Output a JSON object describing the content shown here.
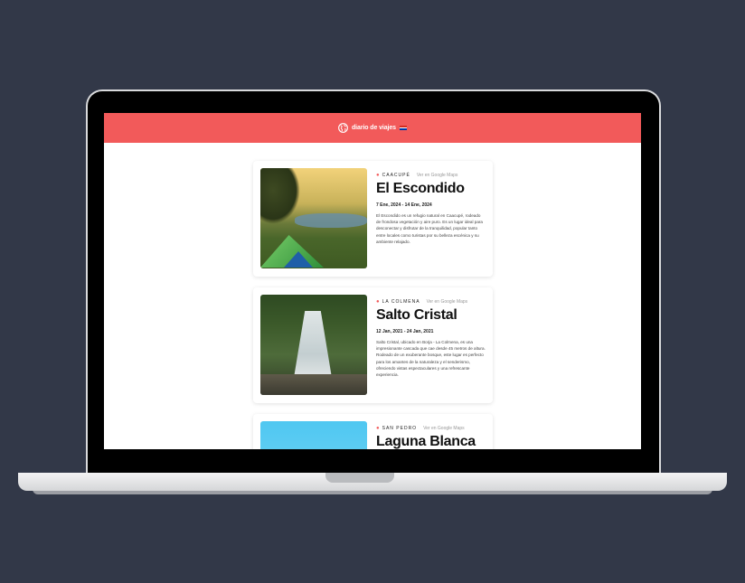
{
  "header": {
    "brand": "diario de viajes",
    "accent": "#f25a5a"
  },
  "cards": [
    {
      "location": "CAACUPÉ",
      "maps_link": "Ver en Google Maps",
      "title": "El Escondido",
      "dates": "7 Ene, 2024 - 14 Ene, 2024",
      "description": "El Escondido es un refugio natural en Caacupé, rodeado de frondosa vegetación y aire puro. Es un lugar ideal para desconectar y disfrutar de la tranquilidad, popular tanto entre locales como turistas por su belleza escénica y su ambiente relajado."
    },
    {
      "location": "LA COLMENA",
      "maps_link": "Ver en Google Maps",
      "title": "Salto Cristal",
      "dates": "12 Jan, 2021 - 24 Jan, 2021",
      "description": "Salto Cristal, ubicado en Borja - La Colmena, es una impresionante cascada que cae desde 45 metros de altura. Rodeado de un exuberante bosque, este lugar es perfecto para los amantes de la naturaleza y el senderismo, ofreciendo vistas espectaculares y una refrescante experiencia."
    },
    {
      "location": "SAN PEDRO",
      "maps_link": "Ver en Google Maps",
      "title": "Laguna Blanca",
      "dates": "",
      "description": ""
    }
  ]
}
